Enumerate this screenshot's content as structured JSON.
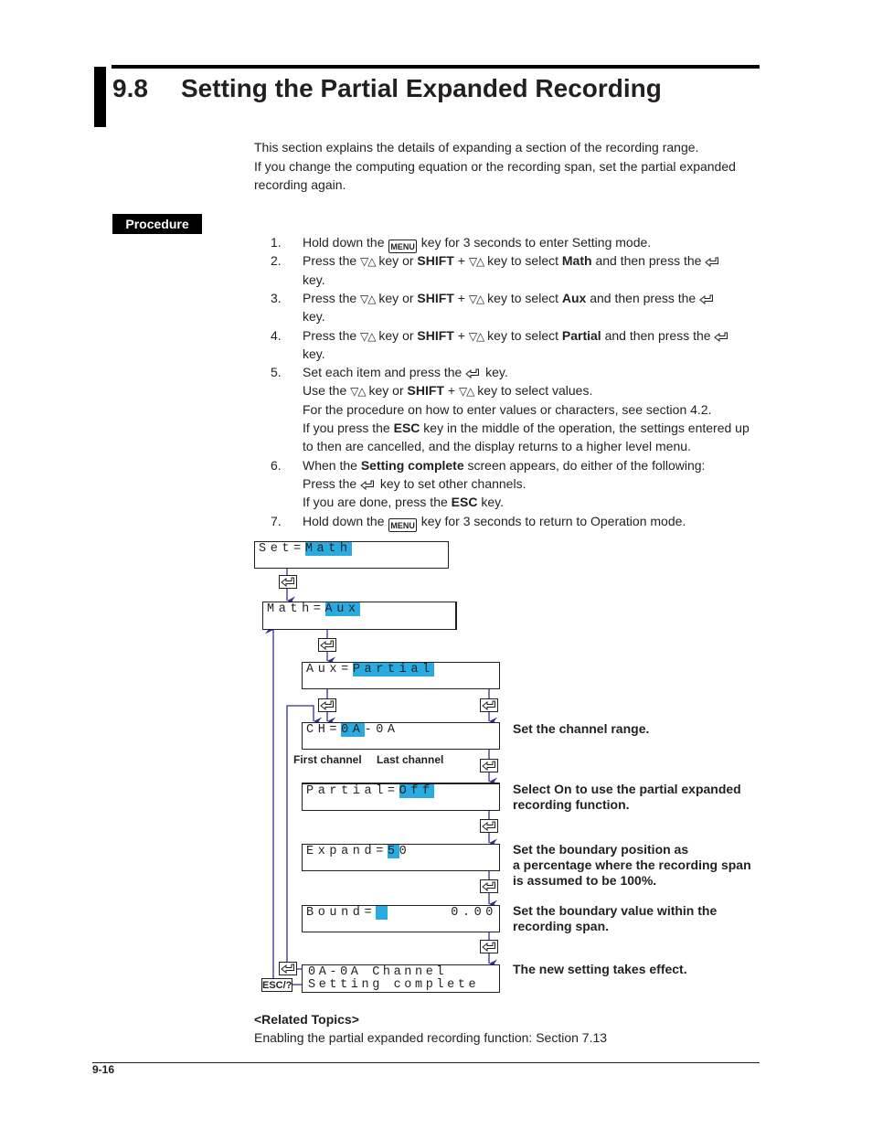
{
  "header": {
    "section_number": "9.8",
    "title": "Setting the Partial Expanded Recording"
  },
  "intro": [
    "This section explains the details of expanding a section of the recording range.",
    "If you change the computing equation or the recording span, set the partial expanded",
    "recording again."
  ],
  "procedure_label": "Procedure",
  "steps": [
    {
      "num": "1.",
      "lines": [
        [
          "Hold down the ",
          {
            "key": "MENU"
          },
          " key for 3 seconds to enter Setting mode."
        ]
      ]
    },
    {
      "num": "2.",
      "lines": [
        [
          "Press the ",
          {
            "icon": "updown"
          },
          " key or ",
          {
            "b": "SHIFT"
          },
          " + ",
          {
            "icon": "updown"
          },
          " key to select ",
          {
            "b": "Math"
          },
          " and then press the ",
          {
            "icon": "enter"
          }
        ],
        [
          "key."
        ]
      ]
    },
    {
      "num": "3.",
      "lines": [
        [
          "Press the ",
          {
            "icon": "updown"
          },
          " key or ",
          {
            "b": "SHIFT"
          },
          " + ",
          {
            "icon": "updown"
          },
          " key to select ",
          {
            "b": "Aux"
          },
          " and then press the ",
          {
            "icon": "enter"
          }
        ],
        [
          "key."
        ]
      ]
    },
    {
      "num": "4.",
      "lines": [
        [
          "Press the ",
          {
            "icon": "updown"
          },
          " key or ",
          {
            "b": "SHIFT"
          },
          " + ",
          {
            "icon": "updown"
          },
          " key to select ",
          {
            "b": "Partial"
          },
          " and then press the ",
          {
            "icon": "enter"
          }
        ],
        [
          "key."
        ]
      ]
    },
    {
      "num": "5.",
      "lines": [
        [
          "Set each item and press the ",
          {
            "icon": "enter"
          },
          " key."
        ],
        [
          "Use the ",
          {
            "icon": "updown"
          },
          " key or ",
          {
            "b": "SHIFT"
          },
          " + ",
          {
            "icon": "updown"
          },
          " key to select values."
        ],
        [
          "For the procedure on how to enter values or characters, see section 4.2."
        ],
        [
          "If you press the ",
          {
            "b": "ESC"
          },
          " key in the middle of the operation, the settings entered up"
        ],
        [
          "to then are cancelled, and the display returns to a higher level menu."
        ]
      ]
    },
    {
      "num": "6.",
      "lines": [
        [
          "When the ",
          {
            "b": "Setting complete"
          },
          " screen appears, do either of the following:"
        ],
        [
          "Press the ",
          {
            "icon": "enter"
          },
          " key to set other channels."
        ],
        [
          "If you are done, press the ",
          {
            "b": "ESC"
          },
          " key."
        ]
      ]
    },
    {
      "num": "7.",
      "lines": [
        [
          "Hold down the ",
          {
            "key": "MENU"
          },
          " key for 3 seconds to return to Operation mode."
        ]
      ]
    }
  ],
  "diagram": {
    "highlight_color": "#29abe2",
    "screens": {
      "set": {
        "prefix": "Set=",
        "value": "Math"
      },
      "math": {
        "prefix": "Math=",
        "value": "Aux"
      },
      "aux": {
        "prefix": "Aux=",
        "value": "Partial"
      },
      "ch": {
        "prefix": "CH=",
        "value": "0A",
        "suffix": "-0A"
      },
      "partial": {
        "prefix": "Partial=",
        "value": "Off"
      },
      "expand": {
        "prefix": "Expand=",
        "value": "5",
        "suffix": "0"
      },
      "bound": {
        "prefix": "Bound=",
        "value": " ",
        "right": "0.00"
      },
      "complete": {
        "line1": "0A-0A Channel",
        "line2": "Setting complete"
      }
    },
    "labels": {
      "first_channel": "First channel",
      "last_channel": "Last channel",
      "esc_key": "ESC/?"
    },
    "notes": {
      "channel": "Set the channel range.",
      "partial": [
        "Select On to use the partial expanded",
        "recording function."
      ],
      "expand": [
        "Set the boundary position as",
        "a percentage where the recording span",
        "is assumed to be 100%."
      ],
      "bound": [
        "Set the boundary value within the",
        "recording span."
      ],
      "complete": "The new setting takes effect."
    }
  },
  "related": {
    "heading": "<Related Topics>",
    "text": "Enabling the partial expanded recording function: Section 7.13"
  },
  "footer": {
    "page": "9-16"
  }
}
